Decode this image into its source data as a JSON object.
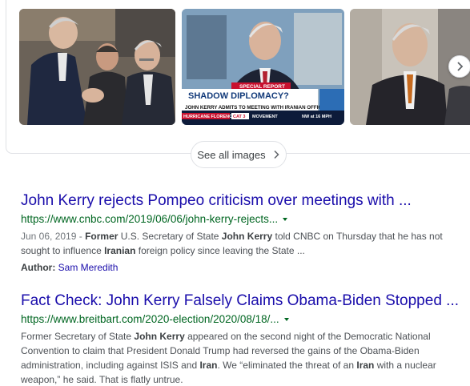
{
  "images": {
    "thumbnails": [
      {
        "alt": "John Kerry meeting officials",
        "icon": "photo-thumbnail"
      },
      {
        "alt": "Shadow diplomacy news segment",
        "icon": "photo-thumbnail",
        "overlay": {
          "headline": "SHADOW DIPLOMACY?",
          "subline": "JOHN KERRY ADMITS TO MEETING WITH IRANIAN OFFICIALS",
          "banner": "SPECIAL REPORT",
          "ticker": [
            "HURRICANE FLORENCE",
            "CAT 3",
            "MOVEMENT",
            "NW at 16 MPH"
          ]
        }
      },
      {
        "alt": "John Kerry portrait",
        "icon": "photo-thumbnail"
      }
    ],
    "next_icon": "chevron-right-icon",
    "see_all_label": "See all images"
  },
  "results": [
    {
      "title": "John Kerry rejects Pompeo criticism over meetings with ...",
      "url": "https://www.cnbc.com/2019/06/06/john-kerry-rejects...",
      "snippet": {
        "date": "Jun 06, 2019 - ",
        "p1": "Former",
        "p2": " U.S. Secretary of State ",
        "p3": "John Kerry",
        "p4": " told CNBC on Thursday that he has not sought to influence ",
        "p5": "Iranian",
        "p6": " foreign policy since leaving the State ..."
      },
      "author_label": "Author:",
      "author_value": "Sam Meredith"
    },
    {
      "title": "Fact Check: John Kerry Falsely Claims Obama-Biden Stopped ...",
      "url": "https://www.breitbart.com/2020-election/2020/08/18/...",
      "snippet": {
        "p1": "Former Secretary of State ",
        "p2": "John Kerry",
        "p3": " appeared on the second night of the Democratic National Convention to claim that President Donald Trump had reversed the gains of the Obama-Biden administration, including against ISIS and ",
        "p4": "Iran",
        "p5": ". We “eliminated the threat of an ",
        "p6": "Iran",
        "p7": " with a nuclear weapon,” he said. That is flatly untrue."
      }
    }
  ],
  "colors": {
    "link": "#1a0dab",
    "url": "#006621",
    "snippet": "#4d5156",
    "border": "#dfe1e5"
  }
}
